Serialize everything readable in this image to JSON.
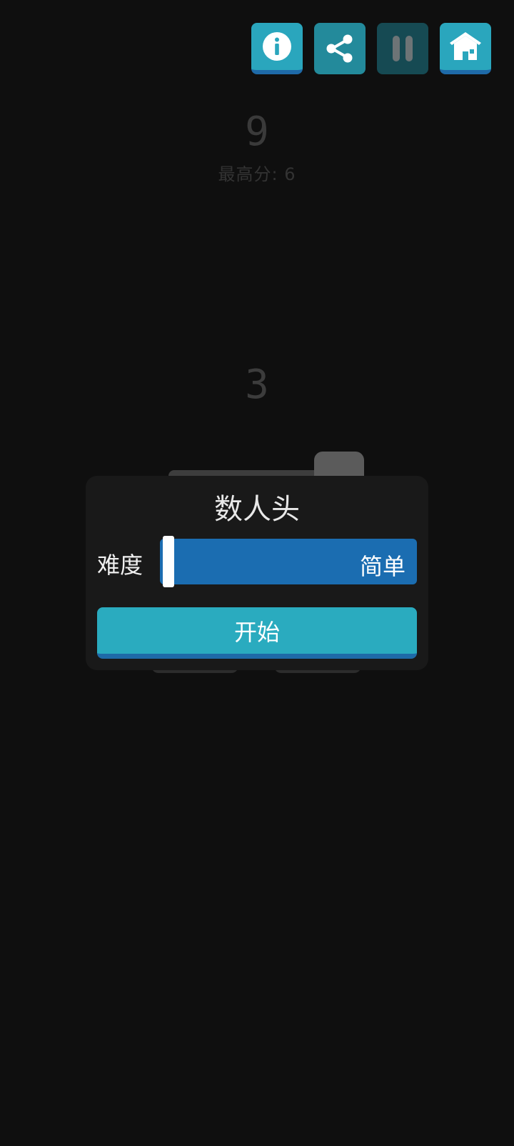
{
  "toolbar": {
    "info_icon": "info-icon",
    "share_icon": "share-icon",
    "pause_icon": "pause-icon",
    "home_icon": "home-icon",
    "accent_color": "#2aa6bd"
  },
  "game": {
    "score": "9",
    "best_score": "最高分: 6",
    "count_number": "3"
  },
  "dialog": {
    "title": "数人头",
    "difficulty_label": "难度",
    "difficulty_value": "简单",
    "start_label": "开始",
    "slider_color": "#1b6db1",
    "button_color": "#2aabbf"
  }
}
